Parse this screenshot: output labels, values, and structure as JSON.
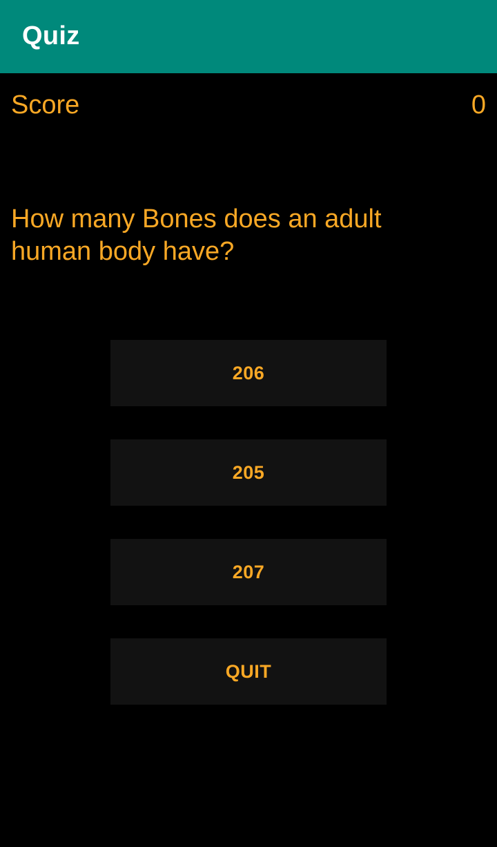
{
  "app_bar": {
    "title": "Quiz",
    "color": "#00897B"
  },
  "score": {
    "label": "Score",
    "value": "0"
  },
  "question": {
    "text": "How many Bones does an adult human body have?"
  },
  "options": [
    {
      "label": "206"
    },
    {
      "label": "205"
    },
    {
      "label": "207"
    }
  ],
  "quit_button": {
    "label": "QUIT"
  },
  "theme": {
    "accent_text": "#F9A825",
    "background": "#000000",
    "button_background": "#121212"
  }
}
